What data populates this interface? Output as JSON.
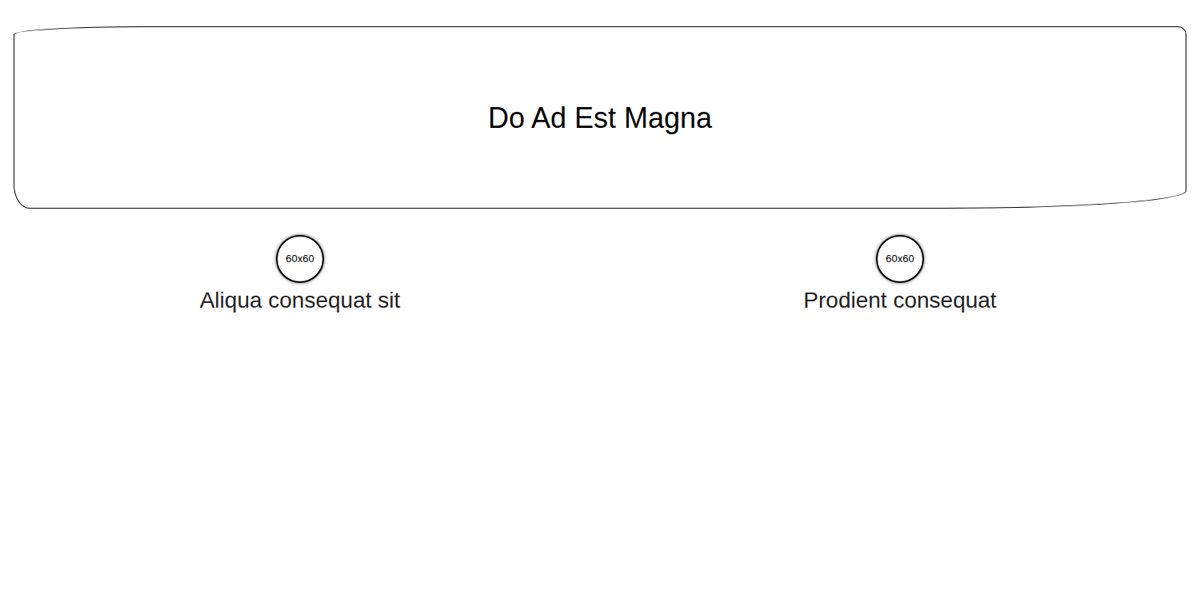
{
  "header": {
    "title": "Do Ad Est Magna"
  },
  "items": [
    {
      "image": "60x60",
      "label": "Aliqua consequat sit"
    },
    {
      "image": "60x60",
      "label": "Prodient consequat"
    }
  ]
}
